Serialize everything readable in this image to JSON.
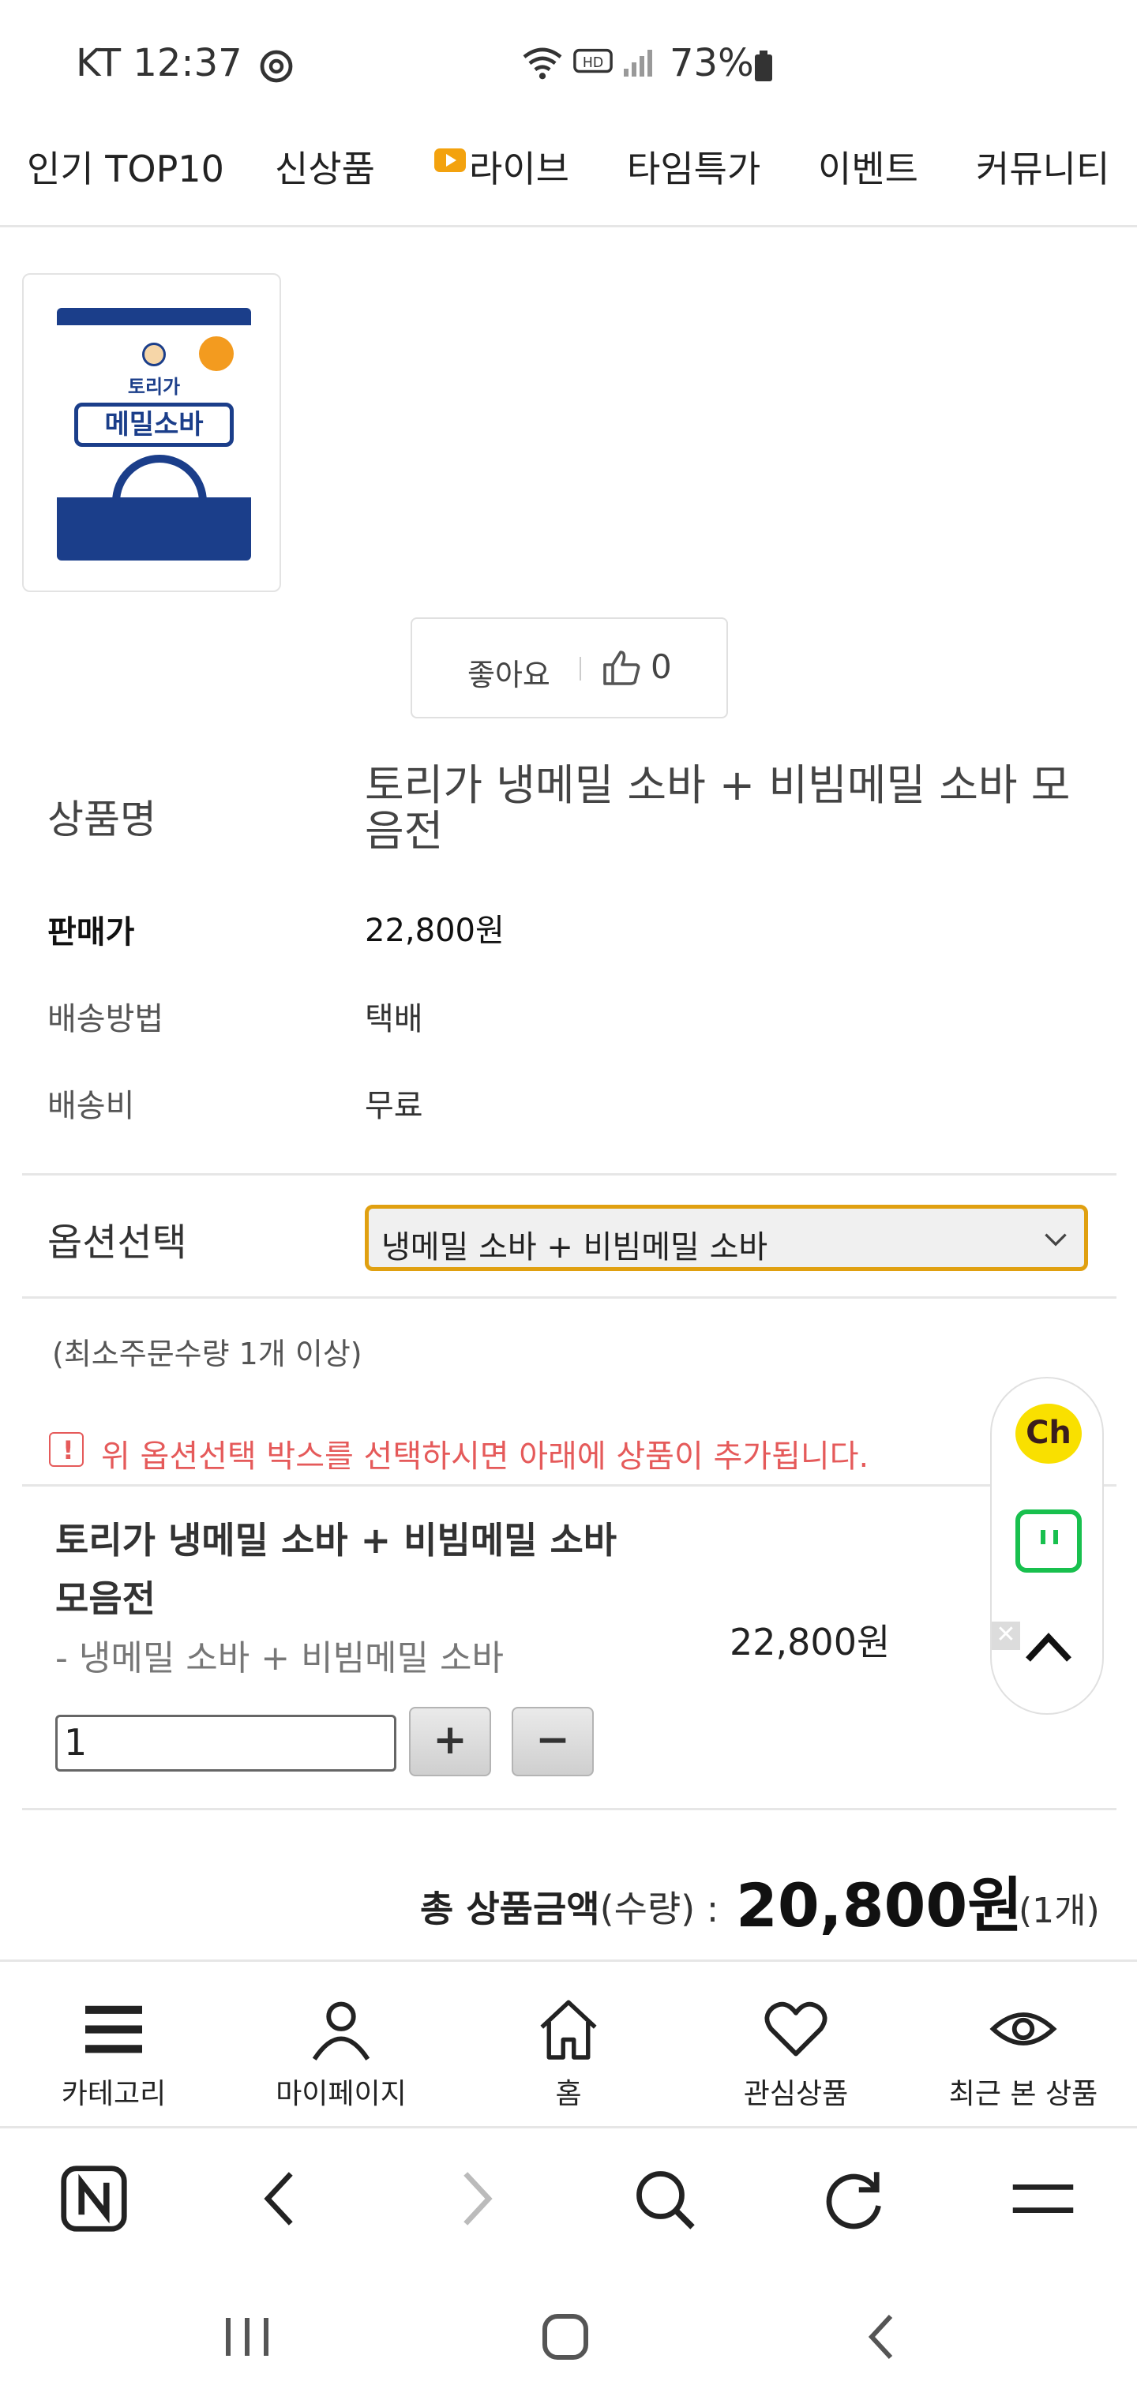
{
  "status_bar": {
    "carrier_time": "KT 12:37",
    "battery": "73%"
  },
  "top_nav": {
    "items": [
      "인기 TOP10",
      "신상품",
      "라이브",
      "타임특가",
      "이벤트",
      "커뮤니티"
    ]
  },
  "like": {
    "label": "좋아요",
    "count": "0"
  },
  "product": {
    "name_label": "상품명",
    "name_value": "토리가 냉메밀 소바 + 비빔메밀 소바 모음전",
    "price_label": "판매가",
    "price_value": "22,800원",
    "ship_method_label": "배송방법",
    "ship_method_value": "택배",
    "ship_fee_label": "배송비",
    "ship_fee_value": "무료",
    "package_brand": "토리가",
    "package_title": "메밀소바"
  },
  "option": {
    "label": "옵션선택",
    "selected": "냉메밀 소바 + 비빔메밀 소바",
    "min_qty_note": "(최소주문수량 1개 이상)",
    "notice": "위 옵션선택 박스를 선택하시면 아래에 상품이 추가됩니다."
  },
  "selected_item": {
    "title": "토리가 냉메밀 소바 + 비빔메밀 소바 모음전",
    "option": "- 냉메밀 소바 + 비빔메밀 소바",
    "price": "22,800원",
    "quantity": "1",
    "plus": "+",
    "minus": "−"
  },
  "total": {
    "label_bold": "총 상품금액",
    "label_rest": "(수량) :",
    "amount": "20,800원",
    "qty": "(1개)"
  },
  "float_menu": {
    "channel": "Ch",
    "close": "✕"
  },
  "bottom_nav": {
    "items": [
      "카테고리",
      "마이페이지",
      "홈",
      "관심상품",
      "최근 본 상품"
    ]
  },
  "colors": {
    "accent": "#e0a010",
    "notice": "#e55a5a",
    "kakao_yellow": "#f9e000",
    "talk_green": "#18c04e",
    "package_blue": "#1b3e8a"
  }
}
